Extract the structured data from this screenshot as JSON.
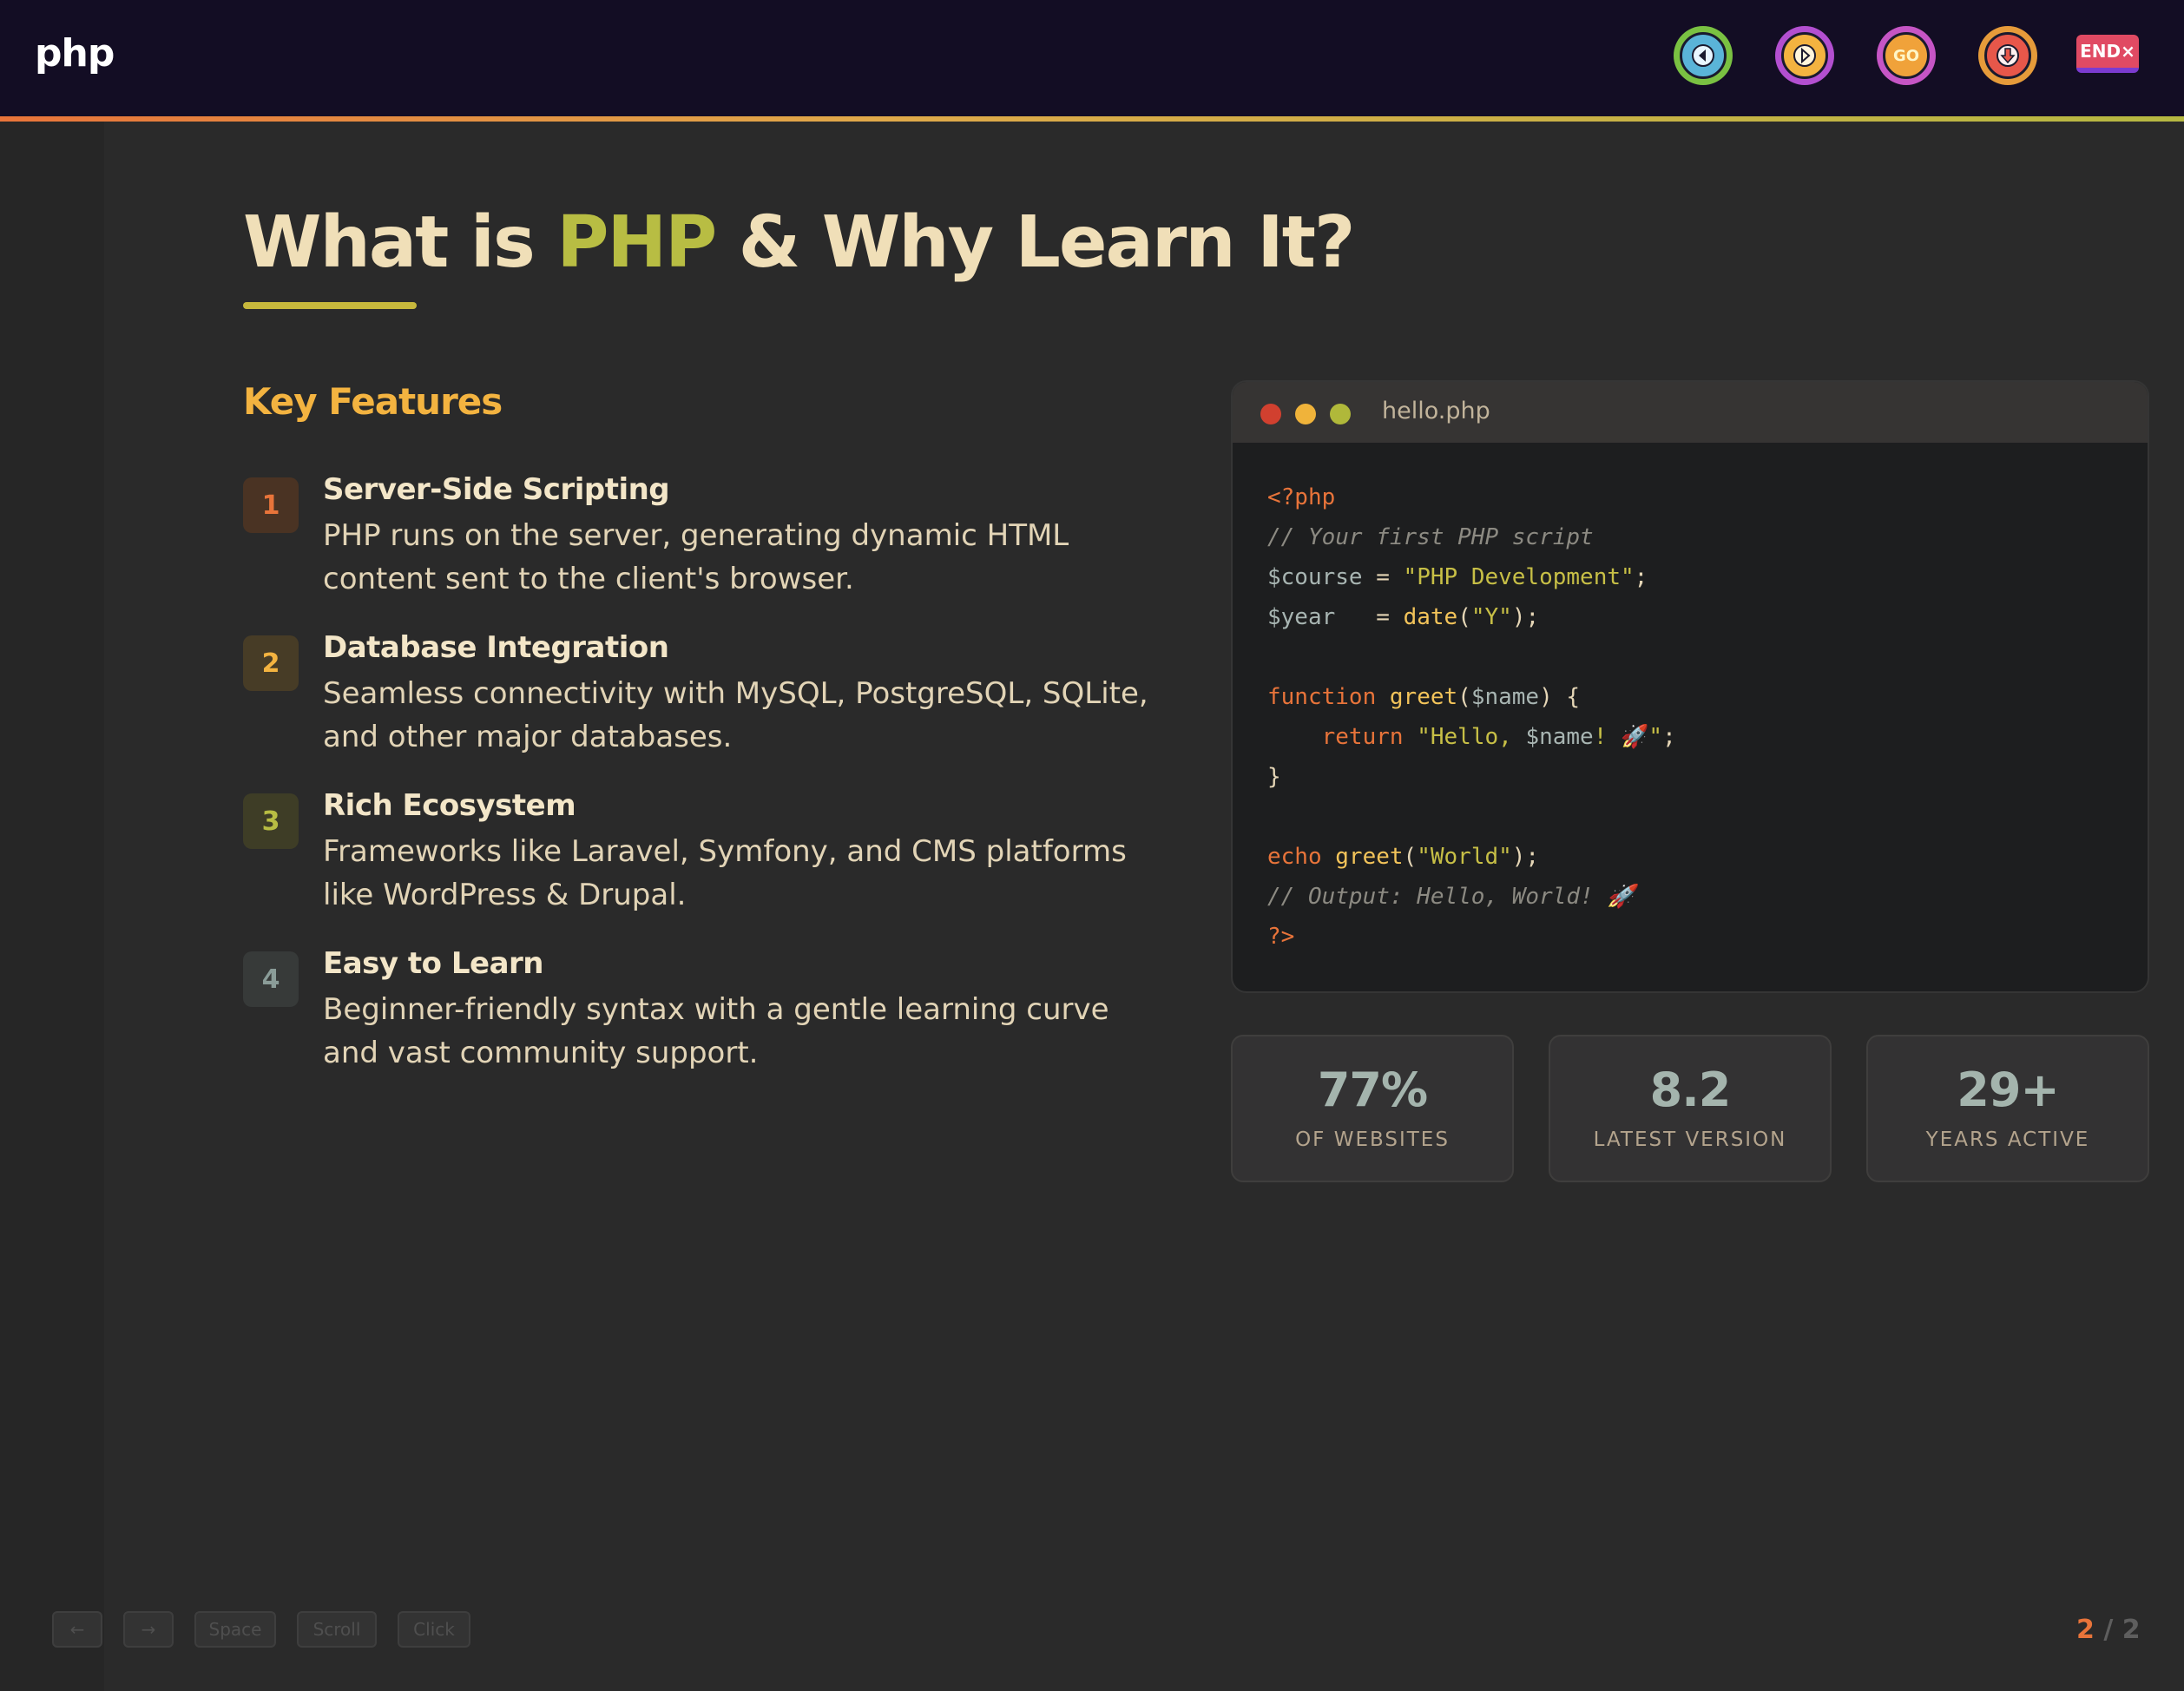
{
  "header": {
    "logo": "php",
    "buttons": {
      "go_label": "GO",
      "end_label": "END×"
    }
  },
  "slide": {
    "title_part1": "What is ",
    "title_accent": "PHP",
    "title_part2": " & Why Learn It?",
    "features_heading": "Key Features",
    "features": [
      {
        "num": "1",
        "title": "Server-Side Scripting",
        "desc": "PHP runs on the server, generating dynamic HTML content sent to the client's browser.",
        "color": "#e8743a"
      },
      {
        "num": "2",
        "title": "Database Integration",
        "desc": "Seamless connectivity with MySQL, PostgreSQL, SQLite, and other major databases.",
        "color": "#f3b340"
      },
      {
        "num": "3",
        "title": "Rich Ecosystem",
        "desc": "Frameworks like Laravel, Symfony, and CMS platforms like WordPress & Drupal.",
        "color": "#b8bd43"
      },
      {
        "num": "4",
        "title": "Easy to Learn",
        "desc": "Beginner-friendly syntax with a gentle learning curve and vast community support.",
        "color": "#8a9c98"
      }
    ],
    "code": {
      "filename": "hello.php",
      "lines": {
        "l1": "<?php",
        "l2": "// Your first PHP script",
        "l3_var": "$course",
        "l3_op": " = ",
        "l3_str": "\"PHP Development\"",
        "l3_end": ";",
        "l4_var": "$year",
        "l4_op": "   = ",
        "l4_fn": "date",
        "l4_paren": "(",
        "l4_str": "\"Y\"",
        "l4_end": ");",
        "l6_kw": "function",
        "l6_fn": " greet",
        "l6_paren": "(",
        "l6_var": "$name",
        "l6_end": ") {",
        "l7_kw": "    return",
        "l7_str": " \"Hello, ",
        "l7_var": "$name",
        "l7_str2": "! 🚀\"",
        "l7_end": ";",
        "l8": "}",
        "l10_kw": "echo",
        "l10_fn": " greet",
        "l10_paren": "(",
        "l10_str": "\"World\"",
        "l10_end": ");",
        "l11": "// Output: Hello, World! 🚀",
        "l12": "?>"
      }
    },
    "stats": [
      {
        "value": "77%",
        "label": "OF WEBSITES"
      },
      {
        "value": "8.2",
        "label": "LATEST VERSION"
      },
      {
        "value": "29+",
        "label": "YEARS ACTIVE"
      }
    ]
  },
  "footer": {
    "hints": [
      "←",
      "→",
      "Space",
      "Scroll",
      "Click"
    ],
    "page_current": "2",
    "page_sep": " / ",
    "page_total": "2"
  }
}
